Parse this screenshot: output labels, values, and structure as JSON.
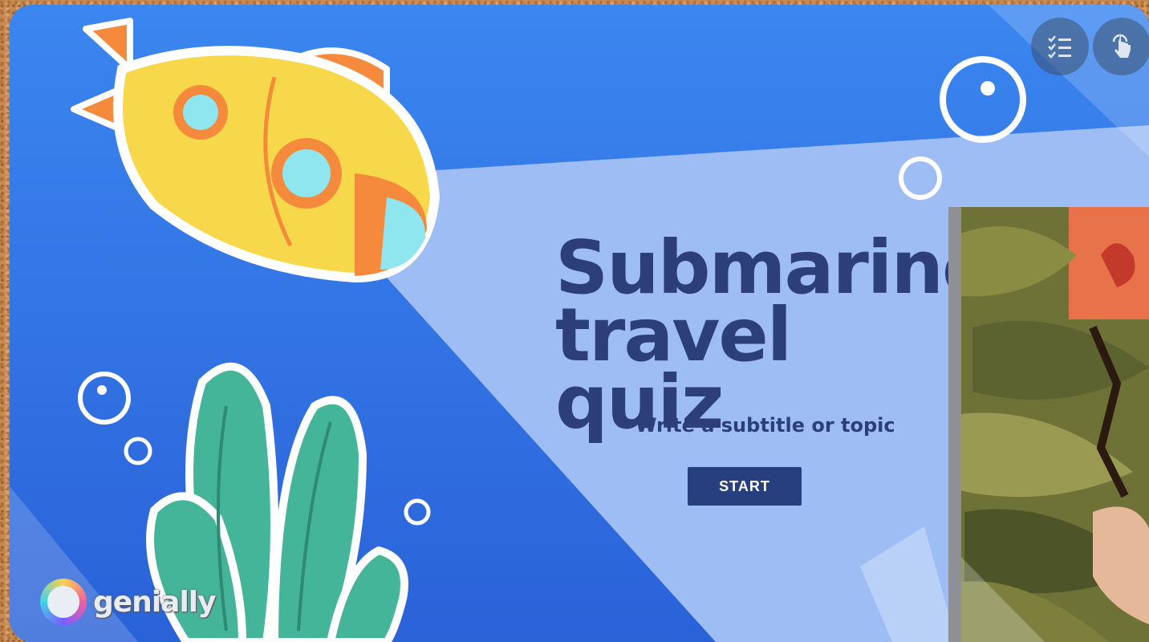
{
  "slide": {
    "title_line1": "Submarine",
    "title_line2": "travel quiz",
    "subtitle": "Write a subtitle or topic",
    "start_label": "START"
  },
  "toolbar": {
    "checklist_icon": "checklist-icon",
    "touch_icon": "hand-pointer-icon"
  },
  "brand": {
    "logo_text": "genially"
  },
  "colors": {
    "ocean_dark": "#2f6fe0",
    "beam": "#9fc0f5",
    "title": "#2d3f78",
    "button": "#283f7f",
    "submarine": "#f7d84a",
    "submarine_trim": "#f58a3c",
    "seaweed": "#45b59a"
  }
}
